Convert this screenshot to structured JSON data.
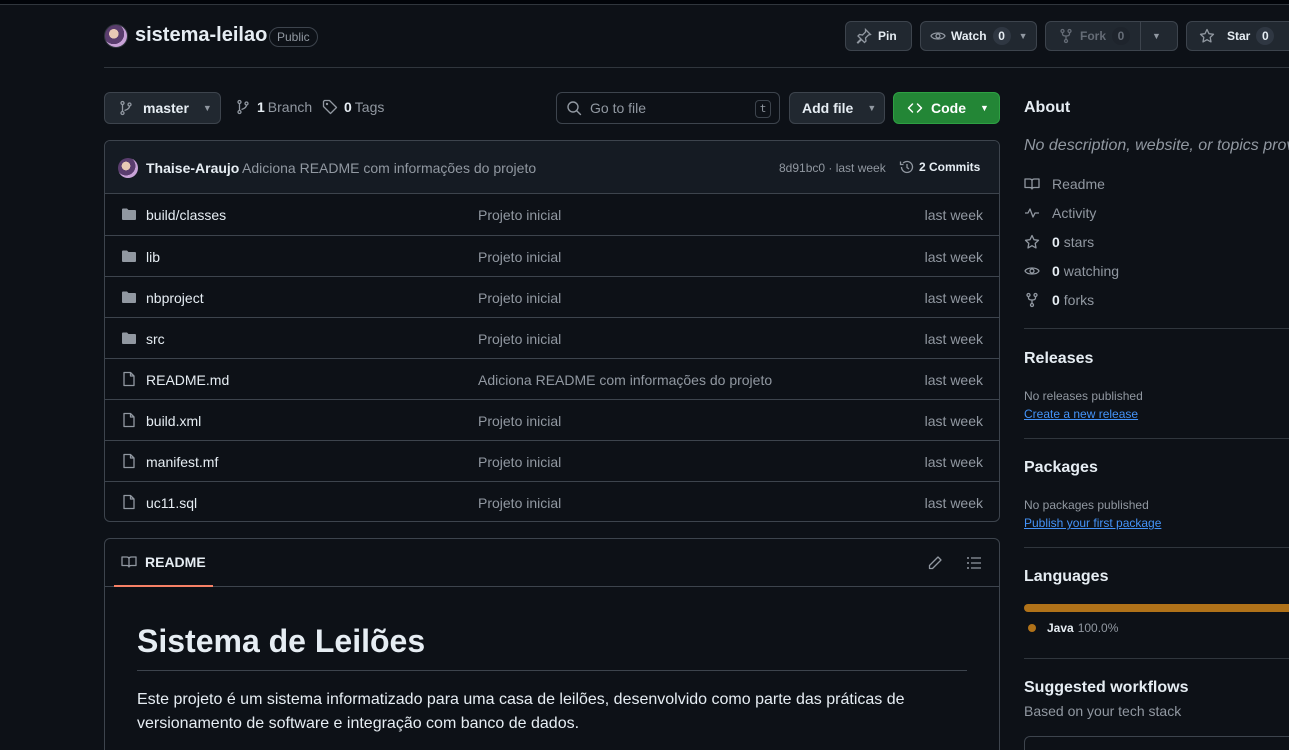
{
  "repo": {
    "name": "sistema-leilao",
    "visibility": "Public",
    "pin_label": "Pin",
    "watch_label": "Watch",
    "watch_count": "0",
    "fork_label": "Fork",
    "fork_count": "0",
    "star_label": "Star",
    "star_count": "0"
  },
  "toolbar": {
    "branch": "master",
    "branch_count": "1",
    "branch_label": "Branch",
    "tag_count": "0",
    "tag_label": "Tags",
    "search_placeholder": "Go to file",
    "search_shortcut": "t",
    "add_file_label": "Add file",
    "code_label": "Code"
  },
  "latest_commit": {
    "author": "Thaise-Araujo",
    "message": "Adiciona README com informações do projeto",
    "hash_date": "8d91bc0 · last week",
    "commits_label": "2 Commits"
  },
  "files": [
    {
      "name": "build/classes",
      "type": "folder",
      "message": "Projeto inicial",
      "date": "last week"
    },
    {
      "name": "lib",
      "type": "folder",
      "message": "Projeto inicial",
      "date": "last week"
    },
    {
      "name": "nbproject",
      "type": "folder",
      "message": "Projeto inicial",
      "date": "last week"
    },
    {
      "name": "src",
      "type": "folder",
      "message": "Projeto inicial",
      "date": "last week"
    },
    {
      "name": "README.md",
      "type": "file",
      "message": "Adiciona README com informações do projeto",
      "date": "last week"
    },
    {
      "name": "build.xml",
      "type": "file",
      "message": "Projeto inicial",
      "date": "last week"
    },
    {
      "name": "manifest.mf",
      "type": "file",
      "message": "Projeto inicial",
      "date": "last week"
    },
    {
      "name": "uc11.sql",
      "type": "file",
      "message": "Projeto inicial",
      "date": "last week"
    }
  ],
  "readme": {
    "tab_label": "README",
    "title": "Sistema de Leilões",
    "body": "Este projeto é um sistema informatizado para uma casa de leilões, desenvolvido como parte das práticas de versionamento de software e integração com banco de dados."
  },
  "about": {
    "heading": "About",
    "description": "No description, website, or topics provided.",
    "readme": "Readme",
    "activity": "Activity",
    "stars_count": "0",
    "stars_label": "stars",
    "watching_count": "0",
    "watching_label": "watching",
    "forks_count": "0",
    "forks_label": "forks"
  },
  "releases": {
    "heading": "Releases",
    "empty": "No releases published",
    "link": "Create a new release"
  },
  "packages": {
    "heading": "Packages",
    "empty": "No packages published",
    "link": "Publish your first package"
  },
  "languages": {
    "heading": "Languages",
    "items": [
      {
        "name": "Java",
        "percent": "100.0%",
        "fraction": 1.0,
        "color": "#b07219"
      }
    ]
  },
  "workflows": {
    "heading": "Suggested workflows",
    "subtitle": "Based on your tech stack"
  },
  "colors": {
    "accent_link": "#4493f8",
    "code_button": "#238636",
    "tab_underline": "#f78166"
  }
}
